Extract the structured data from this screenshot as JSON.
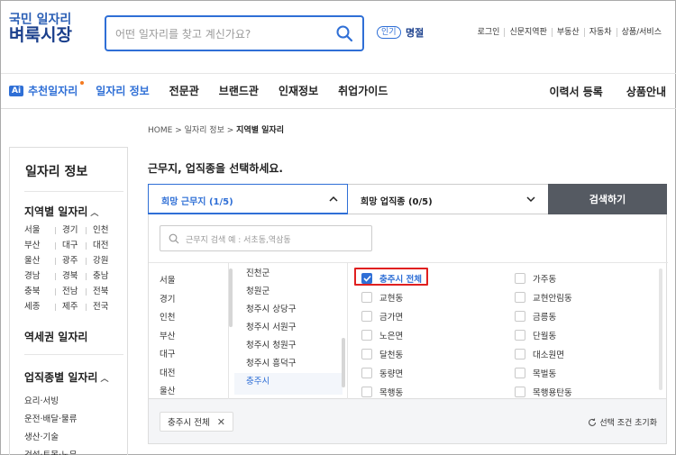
{
  "logo": {
    "line1": "국민 일자리",
    "line2": "벼룩시장"
  },
  "search": {
    "placeholder": "어떤 일자리를 찾고 계신가요?",
    "popular_badge": "인기",
    "popular_word": "명절"
  },
  "utils": [
    "로그인",
    "신문지역판",
    "부동산",
    "자동차",
    "상품/서비스"
  ],
  "nav": {
    "ai_badge": "Ai",
    "recommend": "추천일자리",
    "items": [
      "일자리 정보",
      "전문관",
      "브랜드관",
      "인재정보",
      "취업가이드"
    ],
    "right": [
      "이력서 등록",
      "상품안내"
    ]
  },
  "sidebar": {
    "title": "일자리 정보",
    "region_head": "지역별 일자리",
    "regions": [
      "서울",
      "경기",
      "인천",
      "부산",
      "대구",
      "대전",
      "울산",
      "광주",
      "강원",
      "경남",
      "경북",
      "충남",
      "충북",
      "전남",
      "전북",
      "세종",
      "제주",
      "전국"
    ],
    "station_head": "역세권 일자리",
    "job_head": "업직종별 일자리",
    "jobs": [
      "요리·서빙",
      "운전·배달·물류",
      "생산·기술",
      "건설·토목·노무"
    ]
  },
  "breadcrumb": {
    "home": "HOME",
    "sep": ">",
    "mid": "일자리 정보",
    "current": "지역별 일자리"
  },
  "main": {
    "title": "근무지, 업직종을 선택하세요.",
    "tab_location": "희망 근무지 (1/5)",
    "tab_job": "희망 업직종 (0/5)",
    "search_button": "검색하기",
    "loc_placeholder": "근무지 검색 예 : 서초동,역삼동"
  },
  "col1": [
    "서울",
    "경기",
    "인천",
    "부산",
    "대구",
    "대전",
    "울산"
  ],
  "col2": [
    "진천군",
    "청원군",
    "청주시 상당구",
    "청주시 서원구",
    "청주시 청원구",
    "청주시 흥덕구",
    "충주시"
  ],
  "checks_left": [
    "충주시 전체",
    "교현동",
    "금가면",
    "노은면",
    "달천동",
    "동량면",
    "목행동"
  ],
  "checks_right": [
    "가주동",
    "교현안림동",
    "금릉동",
    "단월동",
    "대소원면",
    "목벌동",
    "목행용탄동"
  ],
  "selected": {
    "chip": "충주시 전체",
    "chip_x": "✕",
    "reset": "선택 조건 초기화"
  }
}
